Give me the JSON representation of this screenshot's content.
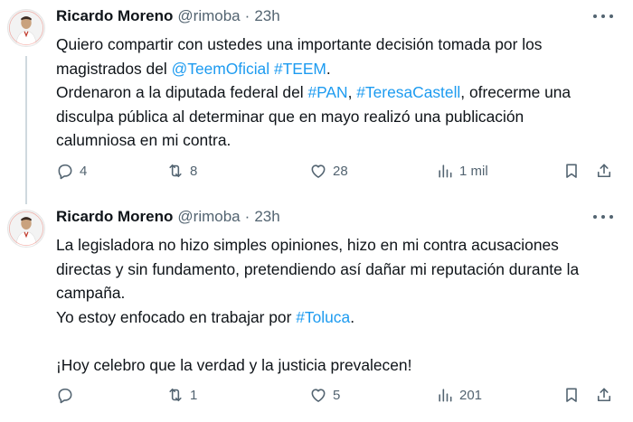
{
  "tweets": [
    {
      "author_name": "Ricardo Moreno",
      "handle": "@rimoba",
      "separator": "·",
      "time": "23h",
      "lines": [
        [
          {
            "text": "Quiero compartir con ustedes una importante decisión tomada por los"
          }
        ],
        [
          {
            "text": "magistrados del "
          },
          {
            "text": "@TeemOficial",
            "link": true
          },
          {
            "text": " "
          },
          {
            "text": "#TEEM",
            "link": true
          },
          {
            "text": "."
          }
        ],
        [
          {
            "text": "Ordenaron a la diputada federal del "
          },
          {
            "text": "#PAN",
            "link": true
          },
          {
            "text": ", "
          },
          {
            "text": "#TeresaCastell",
            "link": true
          },
          {
            "text": ", ofrecerme una"
          }
        ],
        [
          {
            "text": "disculpa pública al determinar que en mayo realizó una publicación"
          }
        ],
        [
          {
            "text": "calumniosa en mi contra."
          }
        ]
      ],
      "actions": {
        "replies": "4",
        "retweets": "8",
        "likes": "28",
        "views": "1 mil"
      }
    },
    {
      "author_name": "Ricardo Moreno",
      "handle": "@rimoba",
      "separator": "·",
      "time": "23h",
      "lines": [
        [
          {
            "text": "La legisladora no hizo simples opiniones, hizo en mi contra acusaciones"
          }
        ],
        [
          {
            "text": "directas y sin fundamento, pretendiendo así dañar mi reputación durante la"
          }
        ],
        [
          {
            "text": "campaña."
          }
        ],
        [
          {
            "text": "Yo estoy enfocado en trabajar por "
          },
          {
            "text": "#Toluca",
            "link": true
          },
          {
            "text": "."
          }
        ],
        [],
        [
          {
            "text": "¡Hoy celebro que la verdad y la justicia prevalecen!"
          }
        ]
      ],
      "actions": {
        "replies": "",
        "retweets": "1",
        "likes": "5",
        "views": "201"
      }
    }
  ],
  "colors": {
    "link": "#1d9bf0",
    "muted": "#536471",
    "text": "#0f1419"
  },
  "icons": [
    "reply-icon",
    "retweet-icon",
    "like-icon",
    "views-icon",
    "bookmark-icon",
    "share-icon",
    "more-icon"
  ]
}
